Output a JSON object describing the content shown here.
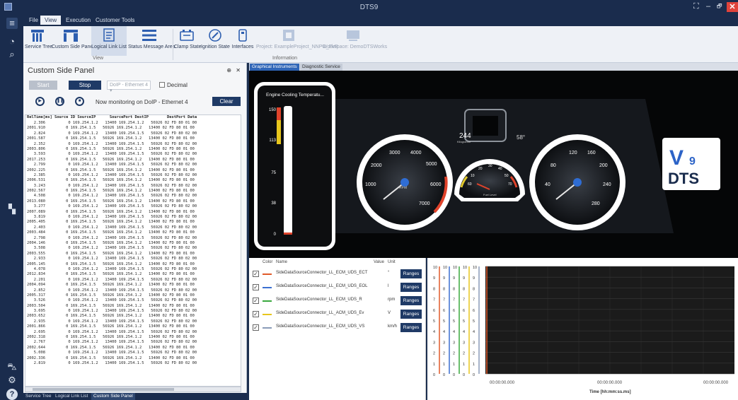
{
  "window": {
    "title": "DTS9",
    "controls": [
      "⛶",
      "–",
      "🗗",
      "✕"
    ]
  },
  "menu": [
    {
      "label": "File"
    },
    {
      "label": "View",
      "active": true
    },
    {
      "label": "Execution"
    },
    {
      "label": "Customer Tools"
    }
  ],
  "ribbon": {
    "view_buttons": [
      {
        "label": "Service Tree",
        "icon": "service-tree-icon"
      },
      {
        "label": "Custom Side Panel",
        "icon": "side-panel-icon"
      },
      {
        "label": "Logical Link List",
        "icon": "list-icon"
      },
      {
        "label": "Status Message Area",
        "icon": "menu-lines-icon"
      }
    ],
    "view_group": "View",
    "info_buttons": [
      {
        "label": "Clamp State",
        "icon": "battery-icon",
        "enabled": true
      },
      {
        "label": "Ignition State",
        "icon": "ignition-icon",
        "enabled": true
      },
      {
        "label": "Interfaces",
        "icon": "interface-icon",
        "enabled": true
      },
      {
        "label": "Project: ExampleProject_NNPO_EvR",
        "icon": "project-icon",
        "enabled": false
      },
      {
        "label": "Workspace: DemoDTSWorks",
        "icon": "workspace-icon",
        "enabled": false
      }
    ],
    "info_group": "Information"
  },
  "side_panel": {
    "title": "Custom Side Panel",
    "pin": "⊕",
    "close": "✕",
    "start_label": "Start",
    "stop_label": "Stop",
    "interface_value": "DoIP - Ethernet 4",
    "decimal_label": "Decimal",
    "monitor_text": "Now monitoring on DoIP - Ethernet 4",
    "clear_label": "Clear",
    "log_header": "RelTime[ms] Source ID SourceIP      SourcePort DestIP        DestPort Data",
    "log_rows": [
      "   2.306          0 169.254.1.2   13400 169.254.1.2   56926 02 FD 80 01 00",
      "2001.910         0 169.254.1.5   56926 169.254.1.2   13400 02 FD 80 01 00",
      "   2.824          0 169.254.1.2   13400 169.254.1.5   56926 02 FD 80 02 00",
      "2001.587         0 169.254.1.5   56926 169.254.1.2   13400 02 FD 80 01 00",
      "   2.352          0 169.254.1.2   13400 169.254.1.5   56926 02 FD 80 02 00",
      "2003.806         0 169.254.1.5   56926 169.254.1.2   13400 02 FD 80 01 00",
      "   3.593          0 169.254.1.2   13400 169.254.1.5   56926 02 FD 80 02 00",
      "2017.253         0 169.254.1.5   56926 169.254.1.2   13400 02 FD 80 01 00",
      "   2.799          0 169.254.1.2   13400 169.254.1.5   56926 02 FD 80 02 00",
      "2002.225         0 169.254.1.5   56926 169.254.1.2   13400 02 FD 80 01 00",
      "   2.385          0 169.254.1.2   13400 169.254.1.5   56926 02 FD 80 02 00",
      "2006.531         0 169.254.1.5   56926 169.254.1.2   13400 02 FD 80 01 00",
      "   3.243          0 169.254.1.2   13400 169.254.1.5   56926 02 FD 80 02 00",
      "2002.567         0 169.254.1.5   56926 169.254.1.2   13400 02 FD 80 01 00",
      "   4.508          0 169.254.1.2   13400 169.254.1.5   56926 02 FD 80 02 00",
      "2013.080         0 169.254.1.5   56926 169.254.1.2   13400 02 FD 80 01 00",
      "   3.277          0 169.254.1.2   13400 169.254.1.5   56926 02 FD 80 02 00",
      "2007.089         0 169.254.1.5   56926 169.254.1.2   13400 02 FD 80 01 00",
      "   3.819          0 169.254.1.2   13400 169.254.1.5   56926 02 FD 80 02 00",
      "2005.405         0 169.254.1.5   56926 169.254.1.2   13400 02 FD 80 01 00",
      "   2.403          0 169.254.1.2   13400 169.254.1.5   56926 02 FD 80 02 00",
      "2003.484         0 169.254.1.5   56926 169.254.1.2   13400 02 FD 80 01 00",
      "   2.798          0 169.254.1.2   13400 169.254.1.5   56926 02 FD 80 02 00",
      "2004.146         0 169.254.1.5   56926 169.254.1.2   13400 02 FD 80 01 00",
      "   3.508          0 169.254.1.2   13400 169.254.1.5   56926 02 FD 80 02 00",
      "2003.555         0 169.254.1.5   56926 169.254.1.2   13400 02 FD 80 01 00",
      "   2.933          0 169.254.1.2   13400 169.254.1.5   56926 02 FD 80 02 00",
      "2005.145         0 169.254.1.5   56926 169.254.1.2   13400 02 FD 80 01 00",
      "   4.078          0 169.254.1.2   13400 169.254.1.5   56926 02 FD 80 02 00",
      "2012.834         0 169.254.1.5   56926 169.254.1.2   13400 02 FD 80 01 00",
      "   2.201          0 169.254.1.2   13400 169.254.1.5   56926 02 FD 80 02 00",
      "2004.094         0 169.254.1.5   56926 169.254.1.2   13400 02 FD 80 01 00",
      "   2.852          0 169.254.1.2   13400 169.254.1.5   56926 02 FD 80 02 00",
      "2005.317         0 169.254.1.5   56926 169.254.1.2   13400 02 FD 80 01 00",
      "   3.526          0 169.254.1.2   13400 169.254.1.5   56926 02 FD 80 02 00",
      "2003.504         0 169.254.1.5   56926 169.254.1.2   13400 02 FD 80 01 00",
      "   3.695          0 169.254.1.2   13400 169.254.1.5   56926 02 FD 80 02 00",
      "2003.652         0 169.254.1.5   56926 169.254.1.2   13400 02 FD 80 01 00",
      "   2.935          0 169.254.1.2   13400 169.254.1.5   56926 02 FD 80 02 00",
      "2001.866         0 169.254.1.5   56926 169.254.1.2   13400 02 FD 80 01 00",
      "   2.695          0 169.254.1.2   13400 169.254.1.5   56926 02 FD 80 02 00",
      "2002.318         0 169.254.1.5   56926 169.254.1.2   13400 02 FD 80 01 00",
      "   2.767          0 169.254.1.2   13400 169.254.1.5   56926 02 FD 80 02 00",
      "2002.644         0 169.254.1.5   56926 169.254.1.2   13400 02 FD 80 01 00",
      "   5.008          0 169.254.1.2   13400 169.254.1.5   56926 02 FD 80 02 00",
      "2002.336         0 169.254.1.5   56926 169.254.1.2   13400 02 FD 80 01 00",
      "   2.819          0 169.254.1.2   13400 169.254.1.5   56926 02 FD 80 02 00"
    ],
    "tabs": [
      {
        "label": "Service Tree"
      },
      {
        "label": "Logical Link List"
      },
      {
        "label": "Custom Side Panel",
        "active": true
      }
    ]
  },
  "doc_tabs": [
    {
      "label": "Graphical Instruments",
      "active": true
    },
    {
      "label": "Diagnostic Service"
    }
  ],
  "dashboard": {
    "bar_gauge": {
      "title": "Engine Cooling Temperatu...",
      "ticks": [
        "150",
        "113",
        "75",
        "38",
        "0"
      ],
      "level": 0
    },
    "speed_value": "244",
    "speed_unit": "Kilogramm",
    "temp_reading": "58°",
    "rpm_ticks": [
      "3000",
      "4000",
      "2000",
      "5000",
      "1000",
      "6000",
      "7000"
    ],
    "rpm_unit": "RPM",
    "fuel_ticks": [
      "20",
      "30",
      "40",
      "10",
      "50",
      "60",
      "70"
    ],
    "fuel_label": "Fuel Level",
    "speed_ticks": [
      "120",
      "160",
      "80",
      "200",
      "40",
      "240",
      "280"
    ],
    "logo_v": "V",
    "logo_9": "9",
    "logo_dts": "DTS"
  },
  "value_table": {
    "headers": {
      "color": "Color",
      "name": "Name",
      "value": "Value",
      "unit": "Unit"
    },
    "range_label": "Ranges",
    "rows": [
      {
        "name": "SideDataSourceConnector_LL_ECM_UDS_ECT",
        "unit": "°",
        "color": "#e05a2a",
        "checked": true
      },
      {
        "name": "SideDataSourceConnector_LL_ECM_UDS_EOL",
        "unit": "l",
        "color": "#3b6fd1",
        "checked": true
      },
      {
        "name": "SideDataSourceConnector_LL_ECM_UDS_R",
        "unit": "rpm",
        "color": "#39a83d",
        "checked": true
      },
      {
        "name": "SideDataSourceConnector_LL_ACM_UDS_Ev",
        "unit": "V",
        "color": "#e8c61c",
        "checked": true
      },
      {
        "name": "SideDataSourceConnector_LL_ECM_UDS_VS",
        "unit": "km/h",
        "color": "#8a9bb8",
        "checked": true
      }
    ]
  },
  "plot": {
    "y_ticks": [
      "10",
      "9",
      "8",
      "7",
      "6",
      "5",
      "4",
      "3",
      "2",
      "1",
      "0"
    ],
    "x_labels": [
      "00:00:00.000",
      "00:00:00.000",
      "00:00:00.000"
    ],
    "x_axis_title": "Time [hh:mm:ss.ms]",
    "series_colors": [
      "#e05a2a",
      "#3b6fd1",
      "#39a83d",
      "#e8c61c",
      "#8a9bb8"
    ]
  },
  "chart_data": {
    "type": "line",
    "xlabel": "Time [hh:mm:ss.ms]",
    "ylabel": "",
    "ylim": [
      0,
      10
    ],
    "series": [
      {
        "name": "SideDataSourceConnector_LL_ECM_UDS_ECT",
        "values": []
      },
      {
        "name": "SideDataSourceConnector_LL_ECM_UDS_EOL",
        "values": []
      },
      {
        "name": "SideDataSourceConnector_LL_ECM_UDS_R",
        "values": []
      },
      {
        "name": "SideDataSourceConnector_LL_ACM_UDS_Ev",
        "values": []
      },
      {
        "name": "SideDataSourceConnector_LL_ECM_UDS_VS",
        "values": []
      }
    ]
  }
}
